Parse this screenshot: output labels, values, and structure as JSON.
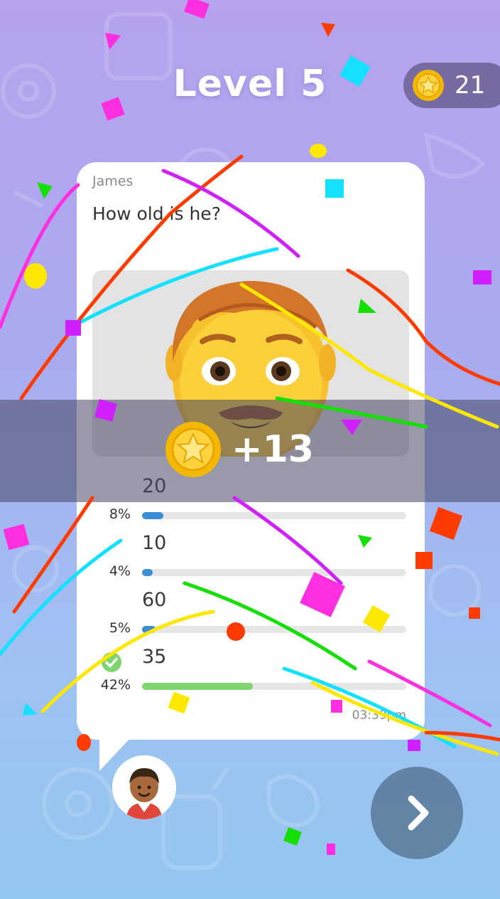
{
  "header": {
    "level_title": "Level 5",
    "coins": "21"
  },
  "question": {
    "author": "James",
    "text": "How old is he?",
    "image_icon": "man-emoji-icon"
  },
  "reward": {
    "amount": "+13"
  },
  "options": [
    {
      "label": "20",
      "percent": "8%",
      "fraction": 0.08,
      "correct": false
    },
    {
      "label": "10",
      "percent": "4%",
      "fraction": 0.04,
      "correct": false
    },
    {
      "label": "60",
      "percent": "5%",
      "fraction": 0.05,
      "correct": false
    },
    {
      "label": "35",
      "percent": "42%",
      "fraction": 0.42,
      "correct": true
    }
  ],
  "timestamp": "03:39pm",
  "colors": {
    "wrong_bar": "#3b8ed6",
    "correct_bar": "#7ed56f",
    "check": "#7ed56f",
    "coin": "#f5b800"
  },
  "icons": [
    "coin-icon",
    "man-emoji-icon",
    "check-icon",
    "avatar-boy-icon",
    "chevron-right-icon"
  ]
}
